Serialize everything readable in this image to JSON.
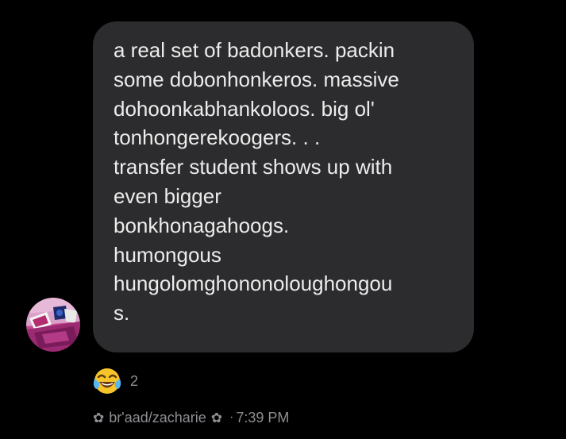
{
  "message": {
    "lines": [
      "a real set of badonkers. packin",
      "some dobonhonkeros. massive",
      "dohoonkabhankoloos. big ol'",
      "tonhongerekoogers. . .",
      "transfer student shows up with",
      "even bigger",
      "bonkhonagahoogs.",
      "humongous",
      "hungolomghononoloughongou",
      "s."
    ]
  },
  "reaction": {
    "emoji_icon": "face-with-tears-of-joy-icon",
    "count": "2"
  },
  "meta": {
    "flower_glyph": "✿",
    "sender": "br'aad/zacharie",
    "separator": "·",
    "time": "7:39 PM"
  },
  "colors": {
    "background": "#000000",
    "bubble": "#2c2c2e",
    "message_text": "#ececec",
    "secondary_text": "#8e8e93"
  }
}
